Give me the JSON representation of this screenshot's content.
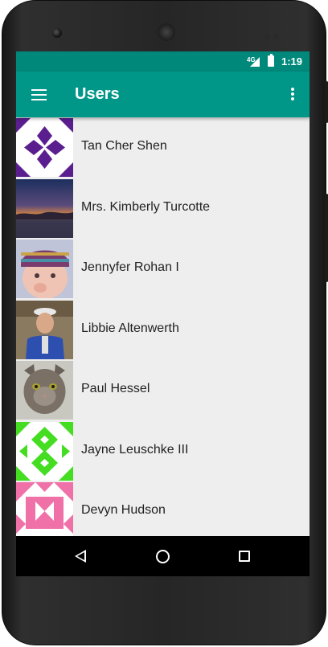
{
  "status_bar": {
    "network": "4G",
    "time": "1:19",
    "icons": [
      "signal-icon",
      "battery-charging-icon"
    ]
  },
  "app_bar": {
    "title": "Users",
    "left_icon": "hamburger-menu-icon",
    "right_icon": "overflow-menu-icon",
    "color": "#009688",
    "status_color": "#00897b"
  },
  "users": [
    {
      "name": "Tan Cher Shen",
      "avatar": "purple-geometric-identicon"
    },
    {
      "name": "Mrs. Kimberly Turcotte",
      "avatar": "sunset-photo"
    },
    {
      "name": "Jennyfer Rohan I",
      "avatar": "child-photo"
    },
    {
      "name": "Libbie Altenwerth",
      "avatar": "person-photo"
    },
    {
      "name": "Paul Hessel",
      "avatar": "cat-photo"
    },
    {
      "name": "Jayne Leuschke III",
      "avatar": "green-geometric-identicon"
    },
    {
      "name": "Devyn Hudson",
      "avatar": "pink-geometric-identicon"
    }
  ],
  "nav_bar": {
    "buttons": [
      "back-icon",
      "home-icon",
      "recents-icon"
    ]
  }
}
